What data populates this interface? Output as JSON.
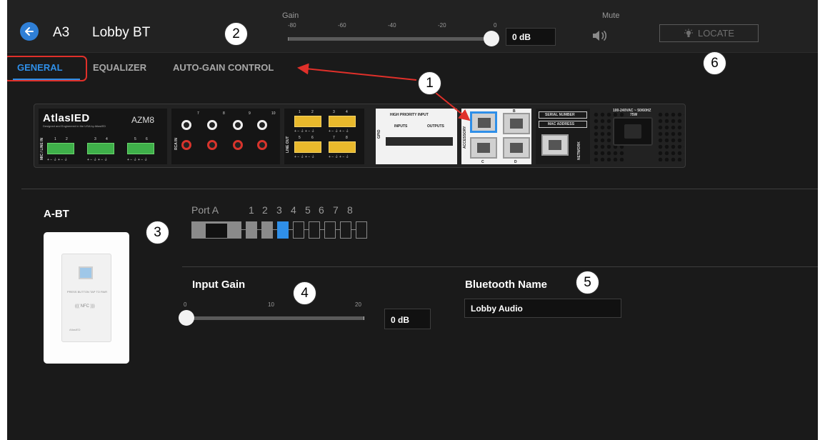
{
  "header": {
    "zone_id": "A3",
    "zone_name": "Lobby BT",
    "gain": {
      "label": "Gain",
      "ticks": [
        "-80",
        "-60",
        "-40",
        "-20",
        "0"
      ],
      "value": "0 dB",
      "level_db": 0
    },
    "mute_label": "Mute",
    "locate_label": "LOCATE"
  },
  "tabs": [
    {
      "label": "GENERAL",
      "active": true
    },
    {
      "label": "EQUALIZER",
      "active": false
    },
    {
      "label": "AUTO-GAIN CONTROL",
      "active": false
    }
  ],
  "device": {
    "brand": "AtlasIED",
    "tagline": "Designed and Engineered in the USA by AtlasIED",
    "model": "AZM8",
    "mic_line_in_label": "MIC / LINE IN",
    "mic_inputs": [
      "1",
      "2",
      "3",
      "4",
      "5",
      "6"
    ],
    "pin_label": "+ − ⏚ + − ⏚",
    "rca_in_label": "RCA IN",
    "rca_inputs": [
      "7",
      "8",
      "9",
      "10"
    ],
    "line_out_label": "LINE OUT",
    "line_outputs": [
      "1",
      "2",
      "3",
      "4",
      "5",
      "6",
      "7",
      "8"
    ],
    "gpio_label": "GPIO",
    "high_priority_input": "HIGH PRIORITY INPUT",
    "inputs_label": "INPUTS",
    "outputs_label": "OUTPUTS",
    "accessory_label": "ACCESSORY",
    "accessory_ports": [
      "A",
      "B",
      "C",
      "D"
    ],
    "serial_number_label": "SERIAL NUMBER",
    "mac_address_label": "MAC ADDRESS",
    "network_label": "NETWORK",
    "power_label": "100-240VAC ~ 50/60HZ",
    "power_watts": "75W"
  },
  "accessory": {
    "title": "A-BT",
    "wallplate_text": "PRESS BUTTON TAP TO PAIR",
    "wallplate_nfc": "((( NFC )))",
    "wallplate_brand": "AtlasIED"
  },
  "port_selector": {
    "label": "Port A",
    "numbers": [
      "1",
      "2",
      "3",
      "4",
      "5",
      "6",
      "7",
      "8"
    ],
    "selected": "3"
  },
  "input_gain": {
    "label": "Input Gain",
    "ticks": [
      "0",
      "10",
      "20"
    ],
    "value": "0 dB",
    "level": 0
  },
  "bluetooth": {
    "label": "Bluetooth Name",
    "value": "Lobby Audio"
  },
  "callouts": [
    "1",
    "2",
    "3",
    "4",
    "5",
    "6"
  ],
  "colors": {
    "accent": "#2f8fe8",
    "annotation_red": "#e0302a",
    "background": "#1a1a1a"
  }
}
